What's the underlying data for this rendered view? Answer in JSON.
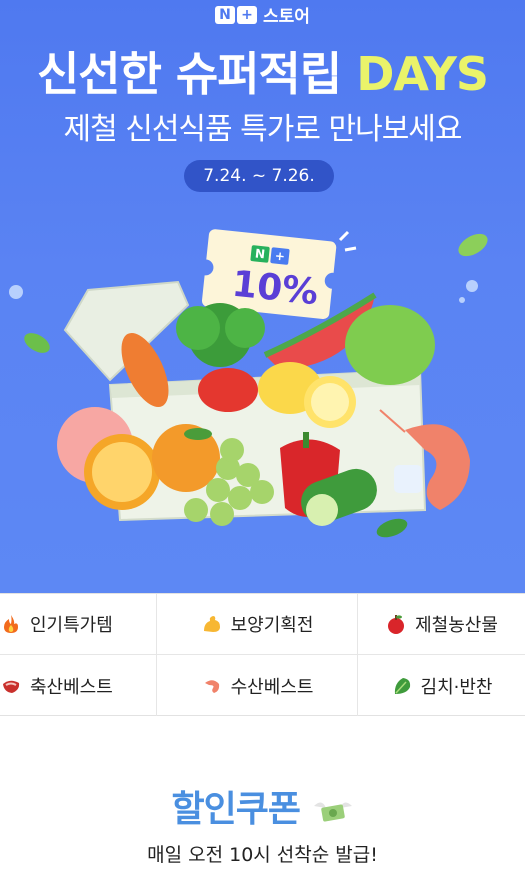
{
  "brand": {
    "logo_n": "N",
    "logo_plus": "+",
    "name": "스토어"
  },
  "hero": {
    "title_main": "신선한 슈퍼적립 ",
    "title_accent": "DAYS",
    "subtitle": "제철 신선식품 특가로 만나보세요",
    "date_range": "7.24. ~ 7.26.",
    "ticket_logo_n": "N",
    "ticket_logo_plus": "+",
    "ticket_percent": "10%"
  },
  "categories": [
    {
      "label": "인기특가템",
      "icon": "fire-icon"
    },
    {
      "label": "보양기획전",
      "icon": "muscle-icon"
    },
    {
      "label": "제철농산물",
      "icon": "apple-icon"
    },
    {
      "label": "축산베스트",
      "icon": "meat-icon"
    },
    {
      "label": "수산베스트",
      "icon": "shrimp-icon"
    },
    {
      "label": "김치·반찬",
      "icon": "leafy-green-icon"
    }
  ],
  "coupon": {
    "title": "할인쿠폰",
    "subtitle": "매일 오전 10시 선착순 발급!"
  },
  "colors": {
    "hero_bg": "#5a83f3",
    "accent_yellow": "#eaf36a",
    "date_pill": "#3154c8",
    "coupon_blue": "#4a8fe0"
  }
}
